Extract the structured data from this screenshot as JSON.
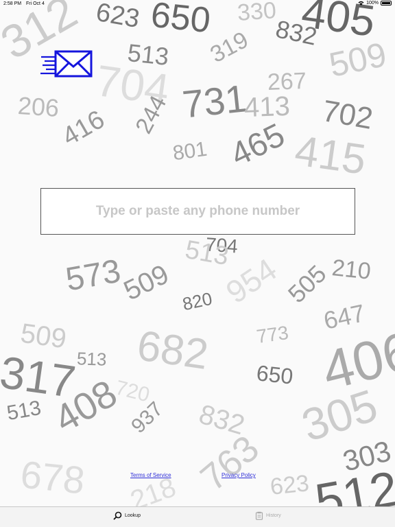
{
  "status_bar": {
    "time": "2:58 PM",
    "date": "Fri Oct 4",
    "battery": "100%"
  },
  "background_numbers": [
    "623",
    "650",
    "330",
    "405",
    "832",
    "312",
    "513",
    "319",
    "509",
    "267",
    "704",
    "731",
    "206",
    "413",
    "702",
    "416",
    "244",
    "801",
    "465",
    "415",
    "704",
    "513",
    "573",
    "509",
    "820",
    "954",
    "505",
    "210",
    "647",
    "773",
    "509",
    "513",
    "682",
    "650",
    "406",
    "317",
    "720",
    "408",
    "513",
    "305",
    "937",
    "832",
    "303",
    "678",
    "763",
    "623",
    "512",
    "218"
  ],
  "search": {
    "placeholder": "Type or paste any phone number",
    "value": ""
  },
  "footer": {
    "terms_label": "Terms of Service",
    "privacy_label": "Privacy Policy"
  },
  "tabs": [
    {
      "label": "Lookup",
      "icon": "search-icon",
      "active": true
    },
    {
      "label": "History",
      "icon": "history-icon",
      "active": false
    }
  ],
  "colors": {
    "accent": "#1515dd",
    "link": "#2a2ad6"
  }
}
